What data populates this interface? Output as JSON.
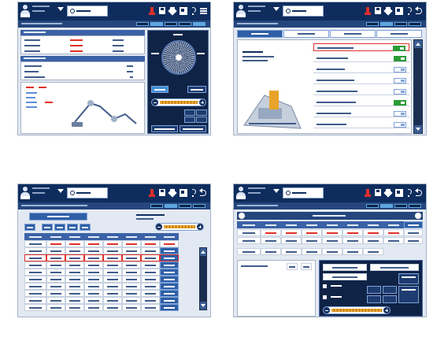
{
  "screens": [
    {
      "id": "monitoring",
      "search_text": "",
      "view": "monitoring"
    },
    {
      "id": "settings",
      "search_text": "",
      "view": "settings-tabs"
    },
    {
      "id": "data-table",
      "search_text": "",
      "view": "table"
    },
    {
      "id": "adjustment",
      "search_text": "",
      "view": "adjust"
    }
  ],
  "toolbar_icons": [
    "alarm-icon",
    "save-icon",
    "star-icon",
    "window-icon",
    "help-icon",
    "back-icon",
    "menu-icon"
  ],
  "colors": {
    "header": "#0e2d5e",
    "subheader": "#25467d",
    "section": "#3b62a6",
    "panel_bg": "#e3e9f2",
    "alert": "#e0302a",
    "toggle_on": "#2c9b36",
    "slider": "#e8a32b"
  },
  "settings_list": {
    "toggle_states": [
      true,
      true,
      false,
      false,
      false,
      true,
      false,
      false
    ]
  }
}
